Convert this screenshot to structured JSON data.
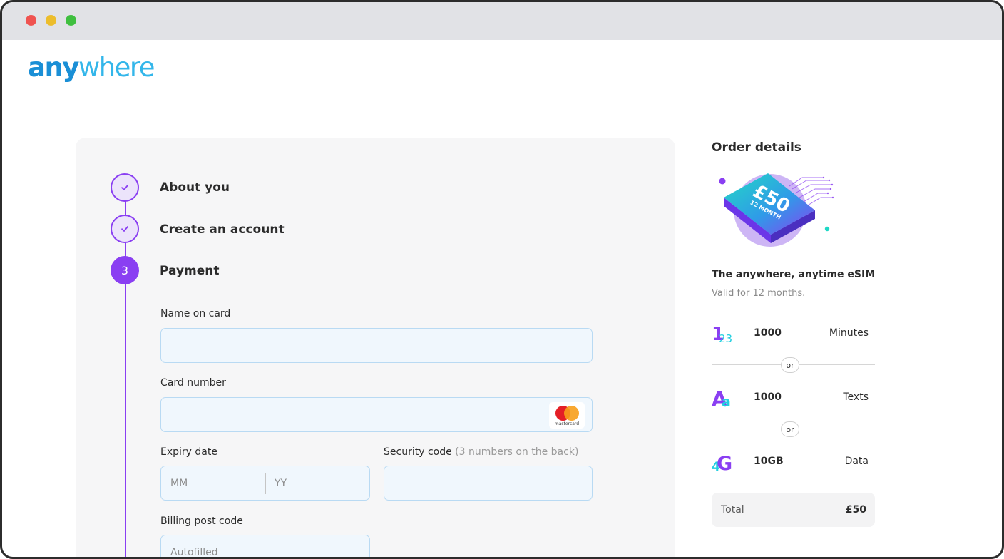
{
  "window": {
    "controls": [
      "close",
      "minimize",
      "maximize"
    ]
  },
  "brand": {
    "logo_part1": "any",
    "logo_part2": "where",
    "colors": {
      "primary": "#1a8fd6",
      "secondary": "#33b6ea",
      "accent": "#8a3ff2"
    }
  },
  "checkout": {
    "steps": [
      {
        "number": "1",
        "label": "About you",
        "status": "done"
      },
      {
        "number": "2",
        "label": "Create an account",
        "status": "done"
      },
      {
        "number": "3",
        "label": "Payment",
        "status": "active"
      }
    ],
    "form": {
      "name_label": "Name on card",
      "name_value": "",
      "card_label": "Card number",
      "card_value": "",
      "card_brand": "mastercard",
      "expiry_label": "Expiry date",
      "expiry_month_placeholder": "MM",
      "expiry_year_placeholder": "YY",
      "security_label": "Security code",
      "security_hint": "(3 numbers on the back)",
      "security_value": "",
      "postcode_label": "Billing post code",
      "postcode_placeholder": "Autofilled"
    }
  },
  "order": {
    "title": "Order details",
    "badge_price": "£50",
    "badge_term": "12 MONTH",
    "product_name": "The anywhere, anytime eSIM",
    "validity": "Valid for 12 months.",
    "items": [
      {
        "icon": "numbers-icon",
        "icon_text_1": "1",
        "icon_text_2": "23",
        "qty": "1000",
        "unit": "Minutes"
      },
      {
        "icon": "text-icon",
        "icon_text_1": "A",
        "icon_text_2": "a",
        "qty": "1000",
        "unit": "Texts"
      },
      {
        "icon": "data-4g-icon",
        "icon_text_1": "4",
        "icon_text_2": "G",
        "qty": "10GB",
        "unit": "Data"
      }
    ],
    "separator_label": "or",
    "total_label": "Total",
    "total_value": "£50"
  }
}
